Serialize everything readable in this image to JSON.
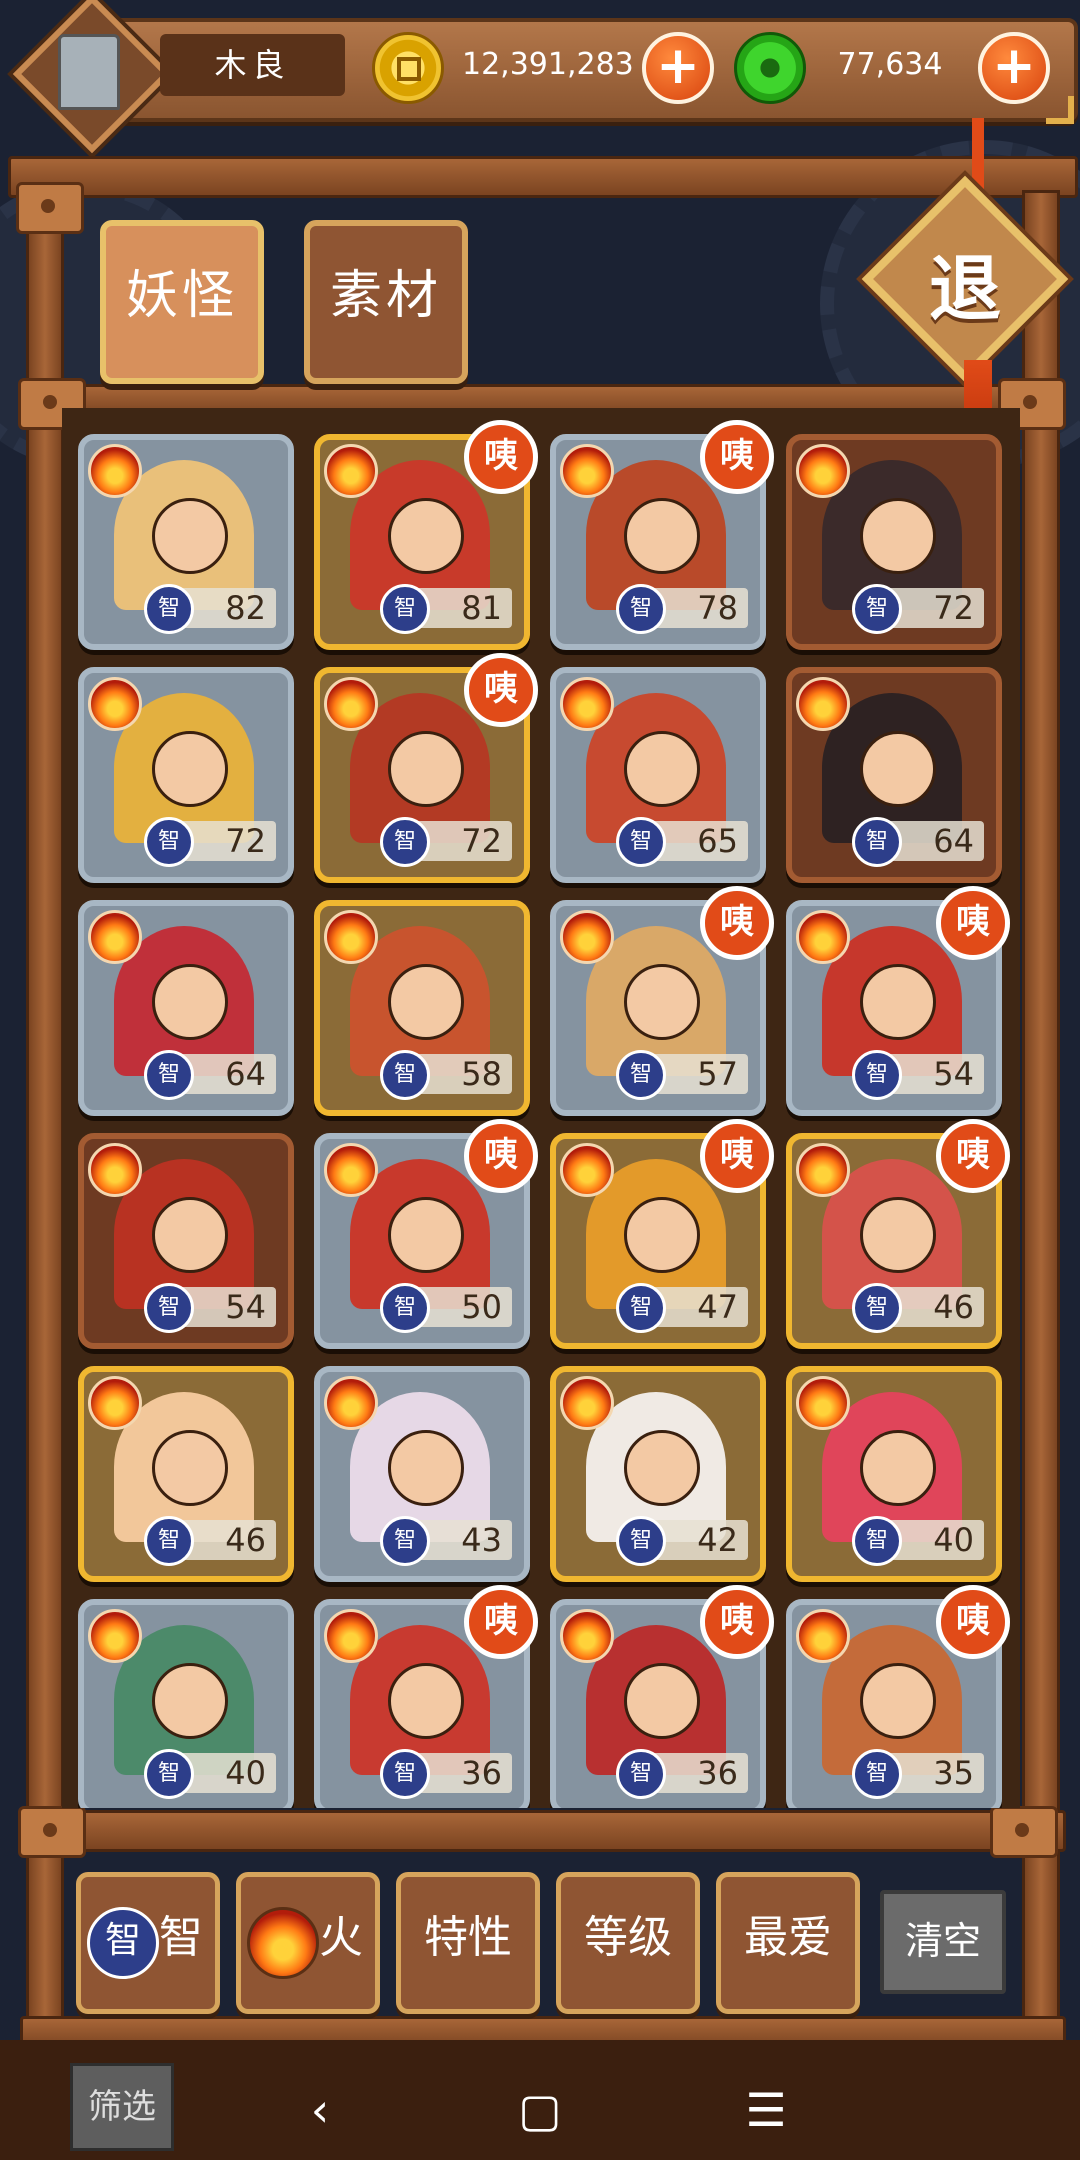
{
  "header": {
    "player_name": "木良",
    "gold_amount": "12,391,283",
    "jade_amount": "77,634",
    "add_label": "+"
  },
  "tabs": [
    {
      "label": "妖怪",
      "active": true
    },
    {
      "label": "素材",
      "active": false
    }
  ],
  "exit_label": "退",
  "stat_icon_label": "智",
  "new_badge_label": "咦",
  "cards": [
    {
      "value": 82,
      "frame": "blue",
      "badge": false
    },
    {
      "value": 81,
      "frame": "gold",
      "badge": true
    },
    {
      "value": 78,
      "frame": "blue",
      "badge": true
    },
    {
      "value": 72,
      "frame": "brown",
      "badge": false
    },
    {
      "value": 72,
      "frame": "blue",
      "badge": false
    },
    {
      "value": 72,
      "frame": "gold",
      "badge": true
    },
    {
      "value": 65,
      "frame": "blue",
      "badge": false
    },
    {
      "value": 64,
      "frame": "brown",
      "badge": false
    },
    {
      "value": 64,
      "frame": "blue",
      "badge": false
    },
    {
      "value": 58,
      "frame": "gold",
      "badge": false
    },
    {
      "value": 57,
      "frame": "blue",
      "badge": true
    },
    {
      "value": 54,
      "frame": "blue",
      "badge": true
    },
    {
      "value": 54,
      "frame": "brown",
      "badge": false
    },
    {
      "value": 50,
      "frame": "blue",
      "badge": true
    },
    {
      "value": 47,
      "frame": "gold",
      "badge": true
    },
    {
      "value": 46,
      "frame": "gold",
      "badge": true
    },
    {
      "value": 46,
      "frame": "gold",
      "badge": false
    },
    {
      "value": 43,
      "frame": "blue",
      "badge": false
    },
    {
      "value": 42,
      "frame": "gold",
      "badge": false
    },
    {
      "value": 40,
      "frame": "gold",
      "badge": false
    },
    {
      "value": 40,
      "frame": "blue",
      "badge": false
    },
    {
      "value": 36,
      "frame": "blue",
      "badge": true
    },
    {
      "value": 36,
      "frame": "blue",
      "badge": true
    },
    {
      "value": 35,
      "frame": "blue",
      "badge": true
    }
  ],
  "filters": [
    {
      "label": "智",
      "icon": "wisdom-icon"
    },
    {
      "label": "火",
      "icon": "fire-icon"
    },
    {
      "label": "特性"
    },
    {
      "label": "等级"
    },
    {
      "label": "最爱"
    }
  ],
  "clear_label": "清空",
  "nav": {
    "filter_label": "筛选",
    "back": "‹",
    "home": "▢",
    "menu": "☰"
  }
}
